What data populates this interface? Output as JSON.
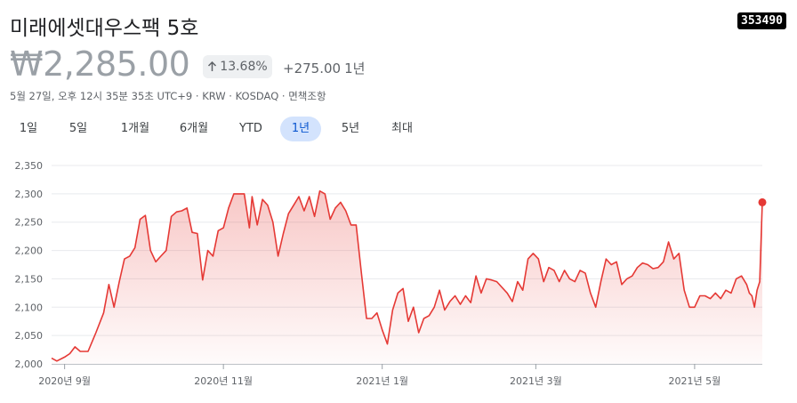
{
  "header": {
    "name": "미래에셋대우스팩 5호",
    "ticker": "353490",
    "price": "₩2,285.00",
    "change_pct": "13.68%",
    "change_abs": "+275.00",
    "change_period": "1년",
    "meta": "5월 27일, 오후 12시 35분 35초 UTC+9 · KRW · KOSDAQ · 면책조항"
  },
  "colors": {
    "line": "#e53935",
    "active_tab_bg": "#d3e3fd",
    "active_tab_text": "#0b57d0"
  },
  "tabs": [
    {
      "label": "1일",
      "active": false
    },
    {
      "label": "5일",
      "active": false
    },
    {
      "label": "1개월",
      "active": false
    },
    {
      "label": "6개월",
      "active": false
    },
    {
      "label": "YTD",
      "active": false
    },
    {
      "label": "1년",
      "active": true
    },
    {
      "label": "5년",
      "active": false
    },
    {
      "label": "최대",
      "active": false
    }
  ],
  "chart_data": {
    "type": "area",
    "ylim": [
      2000,
      2350
    ],
    "yticks": [
      2000,
      2050,
      2100,
      2150,
      2200,
      2250,
      2300,
      2350
    ],
    "xlim": [
      "2020-08-27",
      "2021-05-27"
    ],
    "xticks": [
      {
        "label": "2020년 9월",
        "date": "2020-09-01"
      },
      {
        "label": "2020년 11월",
        "date": "2020-11-01"
      },
      {
        "label": "2021년 1월",
        "date": "2021-01-01"
      },
      {
        "label": "2021년 3월",
        "date": "2021-03-01"
      },
      {
        "label": "2021년 5월",
        "date": "2021-05-01"
      }
    ],
    "grid": true,
    "series": [
      {
        "points": [
          [
            "2020-08-27",
            2010
          ],
          [
            "2020-08-29",
            2005
          ],
          [
            "2020-09-01",
            2012
          ],
          [
            "2020-09-03",
            2018
          ],
          [
            "2020-09-05",
            2030
          ],
          [
            "2020-09-07",
            2022
          ],
          [
            "2020-09-10",
            2022
          ],
          [
            "2020-09-13",
            2055
          ],
          [
            "2020-09-16",
            2090
          ],
          [
            "2020-09-18",
            2140
          ],
          [
            "2020-09-20",
            2100
          ],
          [
            "2020-09-22",
            2145
          ],
          [
            "2020-09-24",
            2185
          ],
          [
            "2020-09-26",
            2190
          ],
          [
            "2020-09-28",
            2205
          ],
          [
            "2020-09-30",
            2255
          ],
          [
            "2020-10-02",
            2262
          ],
          [
            "2020-10-04",
            2200
          ],
          [
            "2020-10-06",
            2180
          ],
          [
            "2020-10-08",
            2190
          ],
          [
            "2020-10-10",
            2200
          ],
          [
            "2020-10-12",
            2260
          ],
          [
            "2020-10-14",
            2268
          ],
          [
            "2020-10-16",
            2270
          ],
          [
            "2020-10-18",
            2275
          ],
          [
            "2020-10-20",
            2232
          ],
          [
            "2020-10-22",
            2230
          ],
          [
            "2020-10-24",
            2148
          ],
          [
            "2020-10-26",
            2200
          ],
          [
            "2020-10-28",
            2190
          ],
          [
            "2020-10-30",
            2235
          ],
          [
            "2020-11-01",
            2240
          ],
          [
            "2020-11-03",
            2275
          ],
          [
            "2020-11-05",
            2300
          ],
          [
            "2020-11-07",
            2300
          ],
          [
            "2020-11-09",
            2300
          ],
          [
            "2020-11-11",
            2240
          ],
          [
            "2020-11-12",
            2295
          ],
          [
            "2020-11-14",
            2245
          ],
          [
            "2020-11-16",
            2290
          ],
          [
            "2020-11-18",
            2280
          ],
          [
            "2020-11-20",
            2250
          ],
          [
            "2020-11-22",
            2190
          ],
          [
            "2020-11-24",
            2230
          ],
          [
            "2020-11-26",
            2265
          ],
          [
            "2020-11-28",
            2280
          ],
          [
            "2020-11-30",
            2295
          ],
          [
            "2020-12-02",
            2270
          ],
          [
            "2020-12-04",
            2295
          ],
          [
            "2020-12-06",
            2260
          ],
          [
            "2020-12-08",
            2305
          ],
          [
            "2020-12-10",
            2300
          ],
          [
            "2020-12-12",
            2255
          ],
          [
            "2020-12-14",
            2275
          ],
          [
            "2020-12-16",
            2285
          ],
          [
            "2020-12-18",
            2270
          ],
          [
            "2020-12-20",
            2245
          ],
          [
            "2020-12-22",
            2245
          ],
          [
            "2020-12-24",
            2160
          ],
          [
            "2020-12-26",
            2080
          ],
          [
            "2020-12-28",
            2080
          ],
          [
            "2020-12-30",
            2090
          ],
          [
            "2021-01-01",
            2060
          ],
          [
            "2021-01-03",
            2035
          ],
          [
            "2021-01-05",
            2095
          ],
          [
            "2021-01-07",
            2125
          ],
          [
            "2021-01-09",
            2133
          ],
          [
            "2021-01-11",
            2075
          ],
          [
            "2021-01-13",
            2100
          ],
          [
            "2021-01-15",
            2055
          ],
          [
            "2021-01-17",
            2080
          ],
          [
            "2021-01-19",
            2085
          ],
          [
            "2021-01-21",
            2100
          ],
          [
            "2021-01-23",
            2130
          ],
          [
            "2021-01-25",
            2095
          ],
          [
            "2021-01-27",
            2110
          ],
          [
            "2021-01-29",
            2120
          ],
          [
            "2021-01-31",
            2105
          ],
          [
            "2021-02-02",
            2120
          ],
          [
            "2021-02-04",
            2108
          ],
          [
            "2021-02-06",
            2155
          ],
          [
            "2021-02-08",
            2125
          ],
          [
            "2021-02-10",
            2150
          ],
          [
            "2021-02-12",
            2148
          ],
          [
            "2021-02-14",
            2145
          ],
          [
            "2021-02-16",
            2135
          ],
          [
            "2021-02-18",
            2125
          ],
          [
            "2021-02-20",
            2110
          ],
          [
            "2021-02-22",
            2145
          ],
          [
            "2021-02-24",
            2130
          ],
          [
            "2021-02-26",
            2185
          ],
          [
            "2021-02-28",
            2195
          ],
          [
            "2021-03-02",
            2185
          ],
          [
            "2021-03-04",
            2145
          ],
          [
            "2021-03-06",
            2170
          ],
          [
            "2021-03-08",
            2165
          ],
          [
            "2021-03-10",
            2145
          ],
          [
            "2021-03-12",
            2165
          ],
          [
            "2021-03-14",
            2150
          ],
          [
            "2021-03-16",
            2145
          ],
          [
            "2021-03-18",
            2165
          ],
          [
            "2021-03-20",
            2160
          ],
          [
            "2021-03-22",
            2125
          ],
          [
            "2021-03-24",
            2100
          ],
          [
            "2021-03-26",
            2145
          ],
          [
            "2021-03-28",
            2185
          ],
          [
            "2021-03-30",
            2175
          ],
          [
            "2021-04-01",
            2180
          ],
          [
            "2021-04-03",
            2140
          ],
          [
            "2021-04-05",
            2150
          ],
          [
            "2021-04-07",
            2155
          ],
          [
            "2021-04-09",
            2170
          ],
          [
            "2021-04-11",
            2178
          ],
          [
            "2021-04-13",
            2175
          ],
          [
            "2021-04-15",
            2168
          ],
          [
            "2021-04-17",
            2170
          ],
          [
            "2021-04-19",
            2180
          ],
          [
            "2021-04-21",
            2215
          ],
          [
            "2021-04-23",
            2185
          ],
          [
            "2021-04-25",
            2195
          ],
          [
            "2021-04-27",
            2130
          ],
          [
            "2021-04-29",
            2100
          ],
          [
            "2021-05-01",
            2100
          ],
          [
            "2021-05-03",
            2120
          ],
          [
            "2021-05-05",
            2120
          ],
          [
            "2021-05-07",
            2115
          ],
          [
            "2021-05-09",
            2125
          ],
          [
            "2021-05-11",
            2115
          ],
          [
            "2021-05-13",
            2130
          ],
          [
            "2021-05-15",
            2125
          ],
          [
            "2021-05-17",
            2150
          ],
          [
            "2021-05-19",
            2155
          ],
          [
            "2021-05-21",
            2140
          ],
          [
            "2021-05-22",
            2125
          ],
          [
            "2021-05-23",
            2120
          ],
          [
            "2021-05-24",
            2100
          ],
          [
            "2021-05-25",
            2130
          ],
          [
            "2021-05-26",
            2145
          ],
          [
            "2021-05-27",
            2285
          ]
        ]
      }
    ]
  }
}
